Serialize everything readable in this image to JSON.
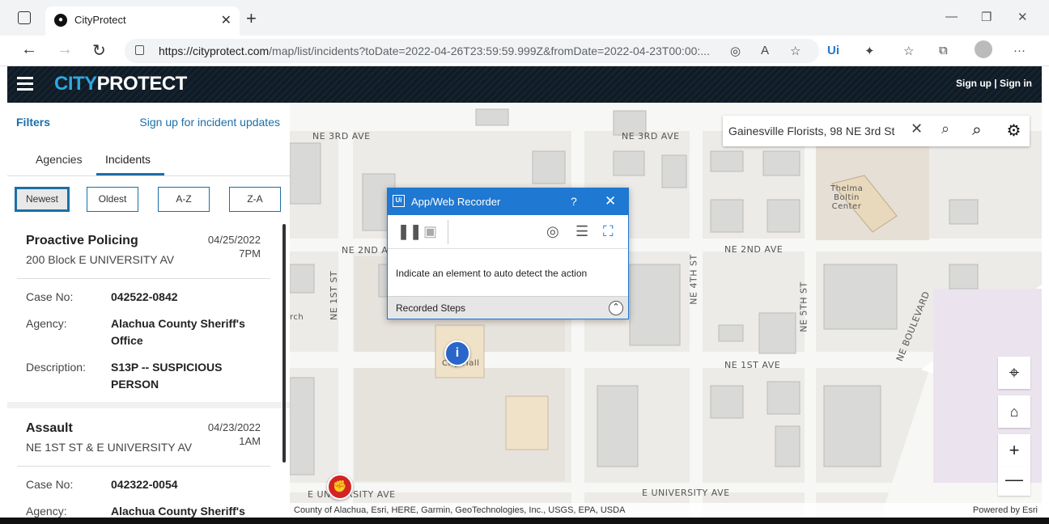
{
  "browser": {
    "tab_title": "CityProtect",
    "url_domain": "https://cityprotect.com",
    "url_path": "/map/list/incidents?toDate=2022-04-26T23:59:59.999Z&fromDate=2022-04-23T00:00:..."
  },
  "header": {
    "logo_city": "CITY",
    "logo_protect": "PROTECT",
    "auth": "Sign up | Sign in"
  },
  "panel": {
    "filters": "Filters",
    "signup_updates": "Sign up for incident updates",
    "tabs": [
      "Agencies",
      "Incidents"
    ],
    "sort_buttons": [
      "Newest",
      "Oldest",
      "A-Z",
      "Z-A"
    ],
    "labels": {
      "case": "Case No:",
      "agency": "Agency:",
      "description": "Description:"
    },
    "incidents": [
      {
        "title": "Proactive Policing",
        "address": "200 Block E UNIVERSITY AV",
        "date": "04/25/2022",
        "time": "7PM",
        "case_no": "042522-0842",
        "agency": "Alachua County Sheriff's Office",
        "description": "S13P -- SUSPICIOUS PERSON"
      },
      {
        "title": "Assault",
        "address": "NE 1ST ST & E UNIVERSITY AV",
        "date": "04/23/2022",
        "time": "1AM",
        "case_no": "042322-0054",
        "agency": "Alachua County Sheriff's"
      }
    ]
  },
  "map": {
    "search_value": "Gainesville Florists, 98 NE 3rd St",
    "roads": {
      "ne3rd_a": "NE 3RD AVE",
      "ne3rd_b": "NE 3RD AVE",
      "ne2nd_a": "NE 2ND AV",
      "ne2nd_b": "NE 2ND AVE",
      "ne1st_ave": "NE 1ST AVE",
      "ne1st_st": "NE 1ST ST",
      "ne4th_st": "NE 4TH ST",
      "ne5th_st": "NE 5TH ST",
      "ne_blvd": "NE BOULEVARD",
      "univ_a": "E UNIVERSITY AVE",
      "univ_b": "E UNIVERSITY AVE"
    },
    "poi_thelma": "Thelma Boltin Center",
    "poi_cityhall": "City Hall",
    "poi_church": "rch",
    "attribution": "County of Alachua, Esri, HERE, Garmin, GeoTechnologies, Inc., USGS, EPA, USDA",
    "powered_by": "Powered by Esri"
  },
  "recorder": {
    "title": "App/Web Recorder",
    "help": "?",
    "message": "Indicate an element to auto detect the action",
    "steps_label": "Recorded Steps"
  }
}
